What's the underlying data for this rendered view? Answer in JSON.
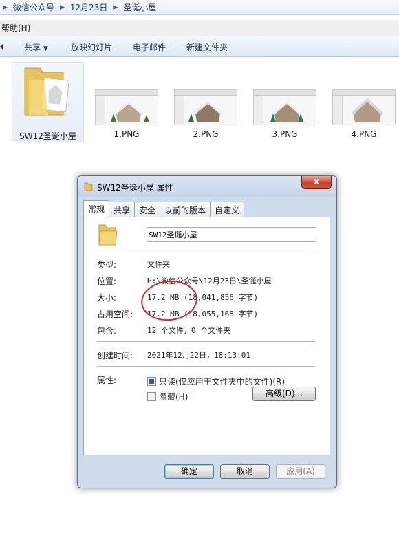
{
  "explorer": {
    "breadcrumbs": [
      "微信公众号",
      "12月23日",
      "圣诞小屋"
    ],
    "menu": {
      "help": "帮助(H)"
    },
    "toolbar": {
      "share": "共享",
      "slideshow": "放映幻灯片",
      "email": "电子邮件",
      "new_folder": "新建文件夹"
    },
    "items": [
      {
        "name": "SW12圣诞小屋",
        "type": "folder",
        "selected": true
      },
      {
        "name": "1.PNG",
        "type": "image"
      },
      {
        "name": "2.PNG",
        "type": "image"
      },
      {
        "name": "3.PNG",
        "type": "image"
      },
      {
        "name": "4.PNG",
        "type": "image"
      }
    ]
  },
  "dialog": {
    "title": "SW12圣诞小屋 属性",
    "tabs": [
      "常规",
      "共享",
      "安全",
      "以前的版本",
      "自定义"
    ],
    "active_tab": "常规",
    "folder_name": "SW12圣诞小屋",
    "fields": {
      "type_label": "类型:",
      "type_value": "文件夹",
      "location_label": "位置:",
      "location_value": "H:\\微信公众号\\12月23日\\圣诞小屋",
      "size_label": "大小:",
      "size_value": "17.2 MB (18,041,856 字节)",
      "disk_size_label": "占用空间:",
      "disk_size_value": "17.2 MB (18,055,168 字节)",
      "contains_label": "包含:",
      "contains_value": "12 个文件，0 个文件夹",
      "created_label": "创建时间:",
      "created_value": "2021年12月22日，18:13:01",
      "attributes_label": "属性:"
    },
    "attributes": {
      "readonly_label": "只读(仅应用于文件夹中的文件)(R)",
      "readonly_state": "indeterminate",
      "hidden_label": "隐藏(H)",
      "hidden_checked": false,
      "advanced_label": "高级(D)..."
    },
    "buttons": {
      "ok": "确定",
      "cancel": "取消",
      "apply": "应用(A)"
    },
    "close_glyph": "x"
  },
  "colors": {
    "annotation": "#e02424",
    "accent": "#1f5fb3"
  }
}
